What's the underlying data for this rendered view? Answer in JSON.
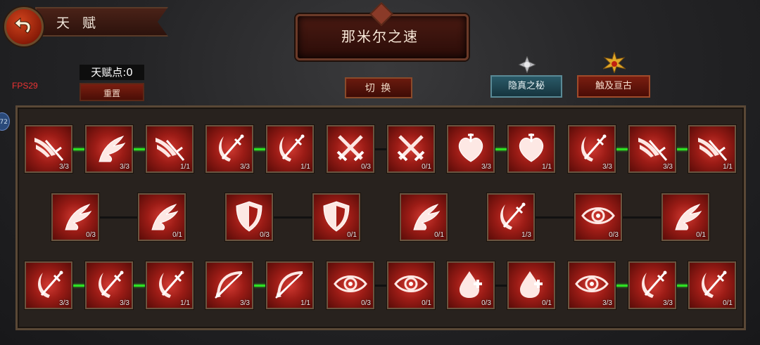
{
  "header": {
    "title": "天 赋",
    "fps": "FPS29",
    "talent_points": "天赋点:0",
    "reset_label": "重置",
    "banner_title": "那米尔之速",
    "switch_label": "切 换",
    "modes": [
      {
        "label": "隐真之秘",
        "color": "#2a5a68"
      },
      {
        "label": "触及亘古",
        "color": "#7a1e10"
      }
    ],
    "side_marker": "72"
  },
  "colors": {
    "link_active": "#2ee024",
    "link_inactive": "#111111",
    "tile_red": "#d23a32"
  },
  "rows": [
    {
      "tiles": [
        {
          "icon": "wing-sword-icon",
          "level": "3/3"
        },
        {
          "icon": "wing-icon",
          "level": "3/3"
        },
        {
          "icon": "wing-sword-icon",
          "level": "1/1"
        },
        {
          "icon": "slash-sword-icon",
          "level": "3/3"
        },
        {
          "icon": "slash-sword-icon",
          "level": "1/1"
        },
        {
          "icon": "crossed-swords-icon",
          "level": "0/3"
        },
        {
          "icon": "crossed-swords-icon",
          "level": "0/1"
        },
        {
          "icon": "heart-icon",
          "level": "3/3"
        },
        {
          "icon": "heart-icon",
          "level": "1/1"
        },
        {
          "icon": "slash-sword-icon",
          "level": "3/3"
        },
        {
          "icon": "wing-sword-icon",
          "level": "3/3"
        },
        {
          "icon": "wing-sword-icon",
          "level": "1/1"
        }
      ],
      "links": [
        "on",
        "on",
        "",
        "on",
        "",
        "off",
        "",
        "on",
        "",
        "on",
        "on"
      ]
    },
    {
      "tiles": [
        {
          "icon": "wing-icon",
          "level": "0/3"
        },
        {
          "icon": "wing-icon",
          "level": "0/1"
        },
        {
          "icon": "shield-icon",
          "level": "0/3"
        },
        {
          "icon": "shield-icon",
          "level": "0/1"
        },
        {
          "icon": "wing-icon",
          "level": "0/1"
        },
        {
          "icon": "slash-sword-icon",
          "level": "1/3"
        },
        {
          "icon": "eye-icon",
          "level": "0/3"
        },
        {
          "icon": "wing-icon",
          "level": "0/1"
        }
      ],
      "links": [
        "off",
        "",
        "off",
        "",
        "",
        "off",
        "off"
      ]
    },
    {
      "tiles": [
        {
          "icon": "slash-sword-icon",
          "level": "3/3"
        },
        {
          "icon": "slash-sword-icon",
          "level": "3/3"
        },
        {
          "icon": "slash-sword-icon",
          "level": "1/1"
        },
        {
          "icon": "bow-icon",
          "level": "3/3"
        },
        {
          "icon": "bow-icon",
          "level": "1/1"
        },
        {
          "icon": "eye-icon",
          "level": "0/3"
        },
        {
          "icon": "eye-icon",
          "level": "0/1"
        },
        {
          "icon": "blood-drop-icon",
          "level": "0/3"
        },
        {
          "icon": "blood-drop-icon",
          "level": "0/1"
        },
        {
          "icon": "eye-icon",
          "level": "3/3"
        },
        {
          "icon": "slash-sword-icon",
          "level": "3/3"
        },
        {
          "icon": "slash-sword-icon",
          "level": "0/1"
        }
      ],
      "links": [
        "on",
        "on",
        "",
        "on",
        "",
        "off",
        "",
        "off",
        "",
        "on",
        "on"
      ]
    }
  ]
}
